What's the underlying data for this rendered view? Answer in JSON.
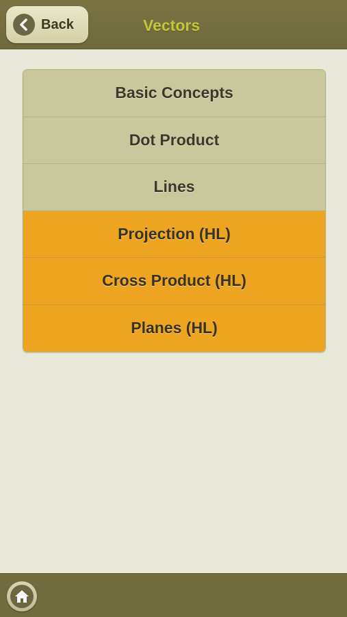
{
  "header": {
    "back_label": "Back",
    "title": "Vectors"
  },
  "menu": {
    "items": [
      {
        "label": "Basic Concepts",
        "tier": "standard"
      },
      {
        "label": "Dot Product",
        "tier": "standard"
      },
      {
        "label": "Lines",
        "tier": "standard"
      },
      {
        "label": "Projection (HL)",
        "tier": "higher-level"
      },
      {
        "label": "Cross Product (HL)",
        "tier": "higher-level"
      },
      {
        "label": "Planes (HL)",
        "tier": "higher-level"
      }
    ]
  },
  "footer": {
    "home_icon": "home-icon"
  },
  "colors": {
    "bar_bg": "#716c3d",
    "page_bg": "#e8e9d8",
    "title": "#c6c53a",
    "standard_item": "#c9c89c",
    "hl_item": "#eda521"
  }
}
